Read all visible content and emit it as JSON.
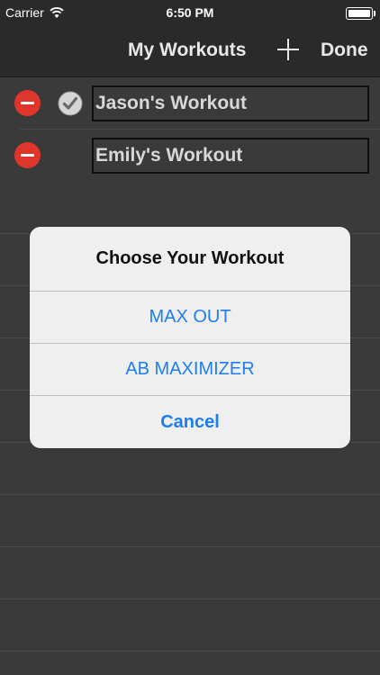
{
  "status_bar": {
    "carrier": "Carrier",
    "time": "6:50 PM",
    "wifi_icon": "wifi-icon",
    "battery_icon": "battery-icon"
  },
  "nav": {
    "title": "My Workouts",
    "add_icon": "plus-icon",
    "done_label": "Done"
  },
  "workouts": [
    {
      "name": "Jason's Workout",
      "selected": true
    },
    {
      "name": "Emily's Workout",
      "selected": false
    }
  ],
  "alert": {
    "title": "Choose Your Workout",
    "options": [
      "MAX OUT",
      "AB MAXIMIZER"
    ],
    "cancel_label": "Cancel"
  },
  "colors": {
    "background": "#3a3a3a",
    "bar": "#2a2a2a",
    "delete": "#e0352b",
    "alert_action": "#1e7ef0"
  }
}
